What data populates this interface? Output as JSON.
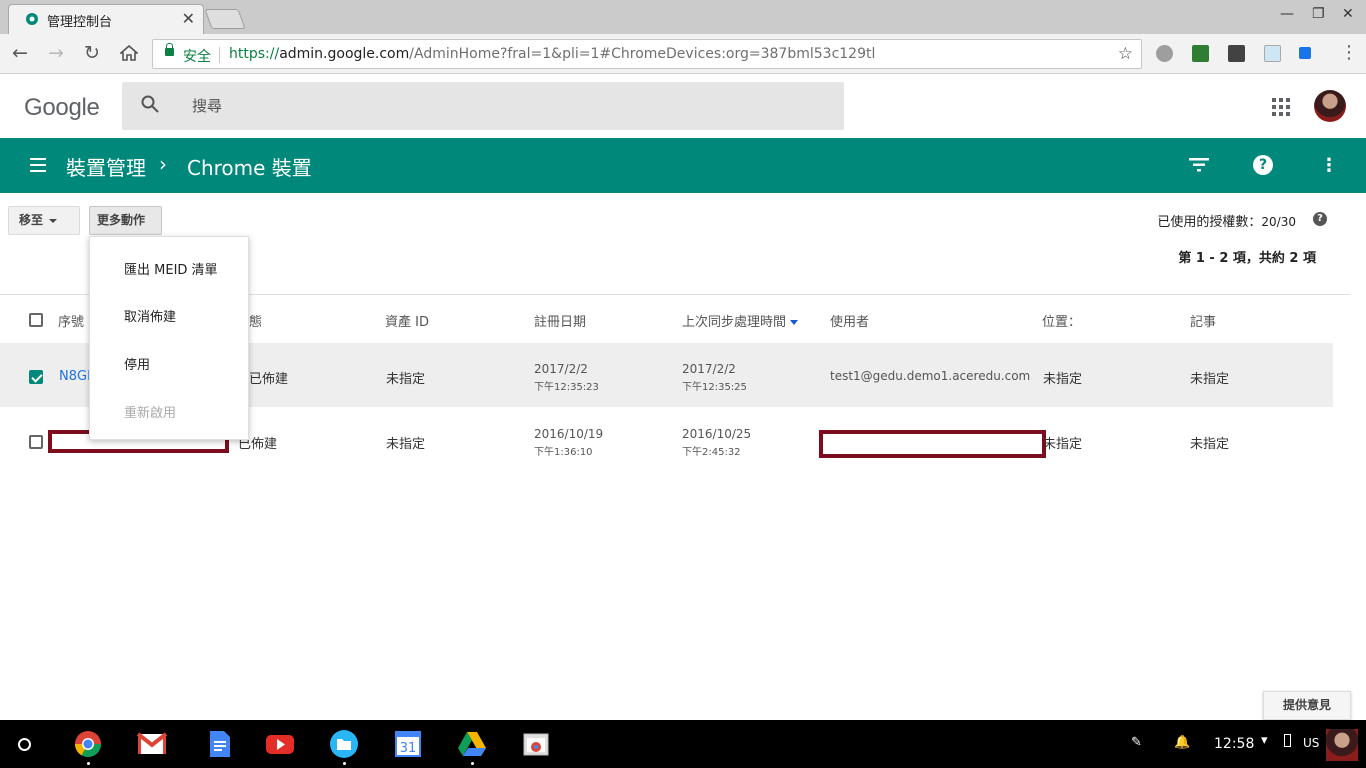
{
  "browser": {
    "tab_title": "管理控制台",
    "secure_label": "安全",
    "url_scheme": "https://",
    "url_host": "admin.google.com",
    "url_path": "/AdminHome?fral=1&pli=1#ChromeDevices:org=387bml53c129tl"
  },
  "header": {
    "logo_text": "Google",
    "search_placeholder": "搜尋"
  },
  "appbar": {
    "breadcrumb_parent": "裝置管理",
    "breadcrumb_separator": "›",
    "breadcrumb_current": "Chrome 裝置"
  },
  "actions": {
    "move_label": "移至",
    "more_label": "更多動作",
    "license_label": "已使用的授權數：",
    "license_count": "20/30",
    "range_label": "第 1 - 2 項，共約 2 項"
  },
  "menu": {
    "items": [
      {
        "label": "匯出 MEID 清單",
        "enabled": true
      },
      {
        "label": "取消佈建",
        "enabled": true
      },
      {
        "label": "停用",
        "enabled": true
      },
      {
        "label": "重新啟用",
        "enabled": false
      }
    ]
  },
  "table": {
    "columns": [
      "序號",
      "態",
      "資產 ID",
      "註冊日期",
      "上次同步處理時間",
      "使用者",
      "位置：",
      "記事"
    ],
    "rows": [
      {
        "checked": true,
        "serial": "N8GN",
        "status": "已佈建",
        "asset_id": "未指定",
        "enroll_date": "2017/2/2",
        "enroll_time": "下午12:35:23",
        "sync_date": "2017/2/2",
        "sync_time": "下午12:35:25",
        "user": "test1@gedu.demo1.aceredu.com",
        "location": "未指定",
        "notes": "未指定"
      },
      {
        "checked": false,
        "serial": "",
        "status": "已佈建",
        "asset_id": "未指定",
        "enroll_date": "2016/10/19",
        "enroll_time": "下午1:36:10",
        "sync_date": "2016/10/25",
        "sync_time": "下午2:45:32",
        "user": "",
        "location": "未指定",
        "notes": "未指定"
      }
    ]
  },
  "feedback_label": "提供意見",
  "shelf": {
    "time": "12:58",
    "input_method": "US",
    "apps": [
      "chrome-icon",
      "gmail-icon",
      "docs-icon",
      "youtube-icon",
      "files-icon",
      "calendar-icon",
      "drive-icon",
      "window-icon"
    ],
    "calendar_day": "31"
  },
  "colors": {
    "appbar": "#00897b",
    "link": "#1a73e8",
    "redaction": "#7b0d1e"
  }
}
